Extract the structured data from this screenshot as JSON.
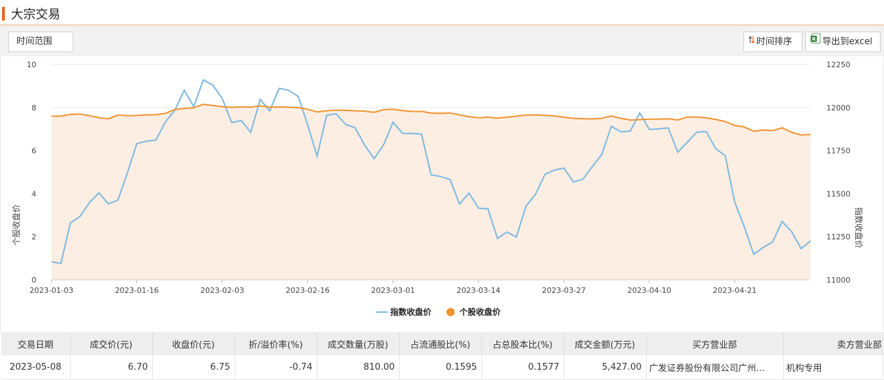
{
  "header": {
    "title": "大宗交易"
  },
  "toolbar": {
    "range_label": "时间范围",
    "sort_label": "时间排序",
    "export_label": "导出到excel"
  },
  "chart_data": {
    "type": "line",
    "ylabel": "个股收盘价",
    "y2label": "指数收盘价",
    "ylim": [
      0,
      10
    ],
    "y2lim": [
      11000,
      12250
    ],
    "yticks": [
      "0",
      "2",
      "4",
      "6",
      "8",
      "10"
    ],
    "y2ticks": [
      "11000",
      "11250",
      "11500",
      "11750",
      "12000",
      "12250"
    ],
    "xticklabels": [
      "2023-01-03",
      "2023-01-16",
      "2023-02-03",
      "2023-02-16",
      "2023-03-01",
      "2023-03-14",
      "2023-03-27",
      "2023-04-10",
      "2023-04-21"
    ],
    "xtick_index": [
      0,
      9,
      18,
      27,
      36,
      45,
      54,
      63,
      72
    ],
    "legend_position": "bottom",
    "colors": {
      "index": "#7ab8e0",
      "stock": "#f0922e",
      "area": "#fdeee3"
    },
    "series": [
      {
        "name": "指数收盘价",
        "axis": "right",
        "values": [
          11106,
          11095,
          11331,
          11367,
          11448,
          11505,
          11441,
          11462,
          11620,
          11791,
          11805,
          11811,
          11916,
          11984,
          12100,
          12005,
          12160,
          12131,
          12052,
          11912,
          11925,
          11856,
          12047,
          11981,
          12112,
          12100,
          12065,
          11900,
          11717,
          11955,
          11964,
          11902,
          11883,
          11783,
          11703,
          11783,
          11915,
          11850,
          11850,
          11845,
          11610,
          11600,
          11583,
          11440,
          11503,
          11416,
          11412,
          11240,
          11278,
          11249,
          11427,
          11495,
          11612,
          11637,
          11649,
          11568,
          11584,
          11657,
          11729,
          11891,
          11859,
          11864,
          11969,
          11873,
          11876,
          11882,
          11741,
          11798,
          11857,
          11861,
          11761,
          11721,
          11452,
          11310,
          11149,
          11188,
          11220,
          11339,
          11280,
          11181,
          11227
        ]
      },
      {
        "name": "个股收盘价",
        "axis": "left",
        "values": [
          7.6,
          7.6,
          7.68,
          7.7,
          7.62,
          7.53,
          7.48,
          7.65,
          7.62,
          7.63,
          7.66,
          7.67,
          7.73,
          7.91,
          7.96,
          7.99,
          8.15,
          8.1,
          8.04,
          8.01,
          8.03,
          8.02,
          8.08,
          8.02,
          8.03,
          8.02,
          8.0,
          7.92,
          7.8,
          7.85,
          7.88,
          7.87,
          7.85,
          7.83,
          7.78,
          7.9,
          7.92,
          7.86,
          7.82,
          7.82,
          7.75,
          7.73,
          7.75,
          7.66,
          7.58,
          7.52,
          7.55,
          7.51,
          7.55,
          7.6,
          7.65,
          7.66,
          7.64,
          7.61,
          7.55,
          7.5,
          7.48,
          7.47,
          7.5,
          7.61,
          7.5,
          7.42,
          7.44,
          7.46,
          7.46,
          7.48,
          7.42,
          7.56,
          7.56,
          7.52,
          7.45,
          7.35,
          7.17,
          7.1,
          6.9,
          6.96,
          6.93,
          7.06,
          6.85,
          6.73,
          6.75
        ]
      }
    ]
  },
  "table": {
    "headers": [
      "交易日期",
      "成交价(元)",
      "收盘价(元)",
      "折/溢价率(%)",
      "成交数量(万股)",
      "占流通股比(%)",
      "占总股本比(%)",
      "成交金额(万元)",
      "买方营业部",
      "卖方营业部"
    ],
    "rows": [
      [
        "2023-05-08",
        "6.70",
        "6.75",
        "-0.74",
        "810.00",
        "0.1595",
        "0.1577",
        "5,427.00",
        "广发证券股份有限公司广州...",
        "机构专用"
      ]
    ]
  }
}
